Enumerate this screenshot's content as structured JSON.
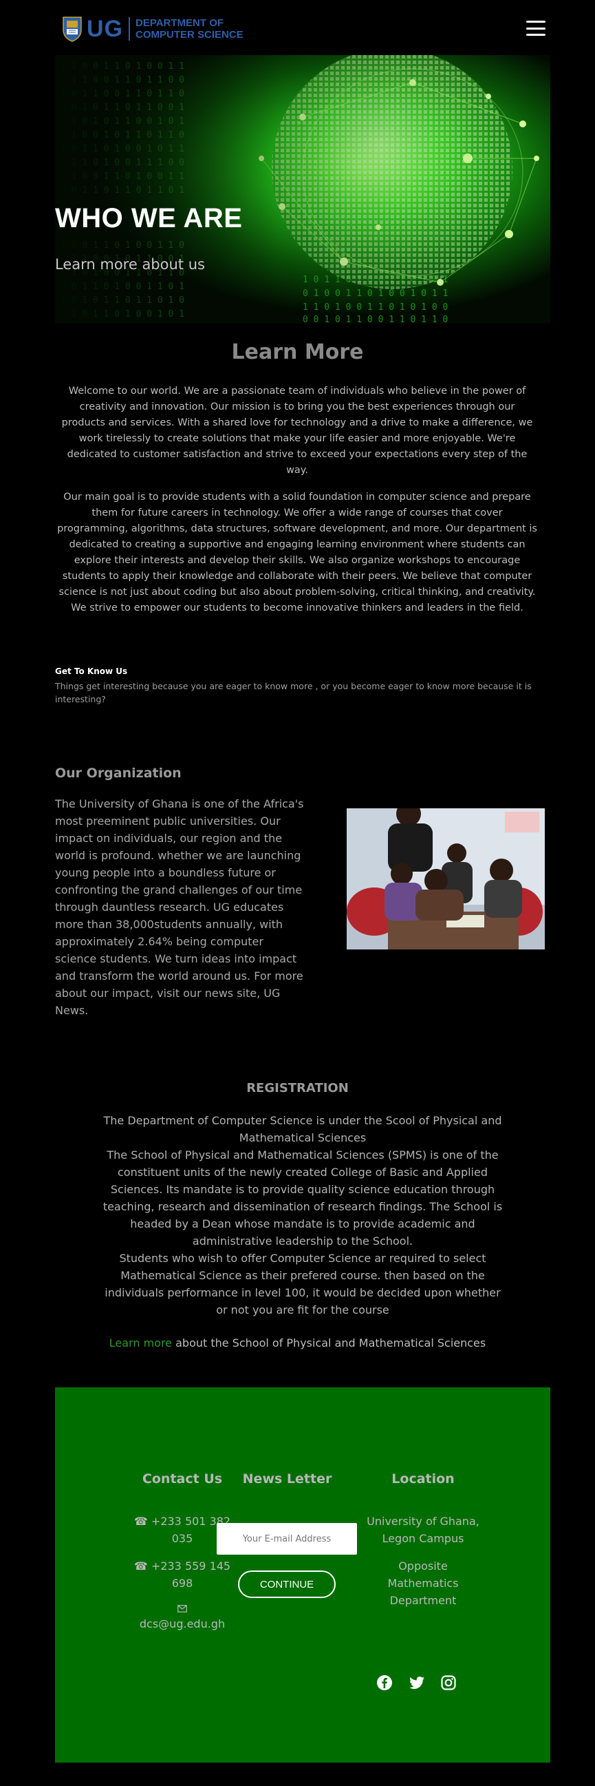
{
  "header": {
    "logo_short": "UG",
    "logo_line1": "DEPARTMENT OF",
    "logo_line2": "COMPUTER SCIENCE",
    "menu_icon": "hamburger-menu-icon"
  },
  "hero": {
    "title": "WHO WE ARE",
    "subtitle": "Learn more about us"
  },
  "learn_more": {
    "title": "Learn More",
    "paragraph1": "Welcome to our world. We are a passionate team of individuals who believe in the power of creativity and innovation. Our mission is to bring you the best experiences through our products and services. With a shared love for technology and a drive to make a difference, we work tirelessly to create solutions that make your life easier and more enjoyable. We're dedicated to customer satisfaction and strive to exceed your expectations every step of the way.",
    "paragraph2": "Our main goal is to provide students with a solid foundation in computer science and prepare them for future careers in technology. We offer a wide range of courses that cover programming, algorithms, data structures, software development, and more. Our department is dedicated to creating a supportive and engaging learning environment where students can explore their interests and develop their skills. We also organize workshops to encourage students to apply their knowledge and collaborate with their peers. We believe that computer science is not just about coding but also about problem-solving, critical thinking, and creativity. We strive to empower our students to become innovative thinkers and leaders in the field."
  },
  "get_to_know": {
    "title": "Get To Know Us",
    "text": "Things get interesting because you are eager to know more , or you become eager to know more because it is interesting?"
  },
  "organization": {
    "title": "Our Organization",
    "text": "The University of Ghana is one of the Africa's most preeminent public universities. Our impact on individuals, our region and the world is profound. whether we are launching young people into a boundless future or confronting the grand challenges of our time through dauntless research. UG educates more than 38,000students annually, with approximately 2.64% being computer science students. We turn ideas into impact and transform the world around us. For more about our impact, visit our news site, UG News."
  },
  "registration": {
    "title": "REGISTRATION",
    "p1": "The Department of Computer Science is under the Scool of Physical and Mathematical Sciences",
    "p2": "The School of Physical and Mathematical Sciences (SPMS) is one of the constituent units of the newly created College of Basic and Applied Sciences. Its mandate is to provide quality science education through teaching, research and dissemination of research findings. The School is headed by a Dean whose mandate is to provide academic and administrative leadership to the School.",
    "p3": "Students who wish to offer Computer Science ar required to select Mathematical Science as their prefered course. then based on the individuals performance in level 100, it would be decided upon whether or not you are fit for the course",
    "link_text": "Learn more",
    "link_suffix": " about the School of Physical and Mathematical Sciences"
  },
  "footer": {
    "contact_title": "Contact Us",
    "phone1_a": "☎ +233 501 382",
    "phone1_b": "035",
    "phone2_a": "☎ +233 559 145",
    "phone2_b": "698",
    "email": "dcs@ug.edu.gh",
    "newsletter_title": "News Letter",
    "email_placeholder": "Your E-mail Address",
    "continue_label": "CONTINUE",
    "location_title": "Location",
    "location_line1": "University of Ghana,",
    "location_line2": "Legon Campus",
    "location_line3": "Opposite",
    "location_line4": "Mathematics",
    "location_line5": "Department",
    "social_icons": [
      "facebook-icon",
      "twitter-icon",
      "instagram-icon"
    ]
  },
  "colors": {
    "background": "#000000",
    "footer_green": "#006d00",
    "link_green": "#2b9a2b",
    "logo_blue": "#2e5fa8"
  }
}
